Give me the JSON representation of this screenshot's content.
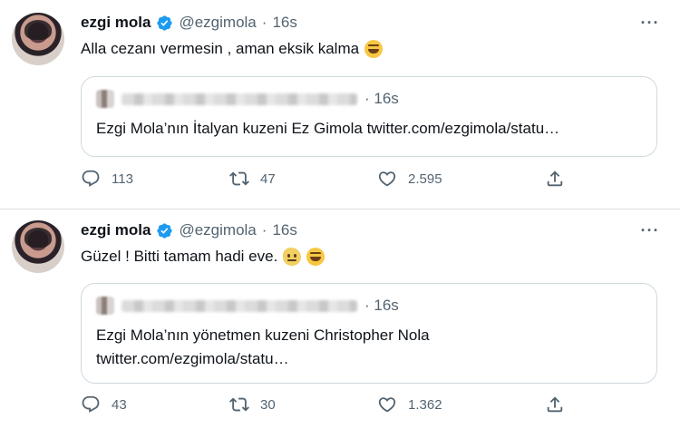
{
  "tweets": [
    {
      "author": {
        "name": "ezgi mola",
        "handle": "@ezgimola",
        "separator": "·",
        "time": "16s"
      },
      "text": "Alla cezanı vermesin , aman eksik kalma",
      "quote": {
        "time": "16s",
        "text": "Ezgi Mola’nın İtalyan kuzeni Ez Gimola twitter.com/ezgimola/statu…"
      },
      "stats": {
        "replies": "113",
        "retweets": "47",
        "likes": "2.595"
      }
    },
    {
      "author": {
        "name": "ezgi mola",
        "handle": "@ezgimola",
        "separator": "·",
        "time": "16s"
      },
      "text": "Güzel ! Bitti tamam hadi eve.",
      "quote": {
        "time": "16s",
        "text_line1": "Ezgi Mola’nın yönetmen kuzeni Christopher Nola",
        "text_line2": "twitter.com/ezgimola/statu…"
      },
      "stats": {
        "replies": "43",
        "retweets": "30",
        "likes": "1.362"
      }
    }
  ],
  "icons": {
    "verified": "verified-badge-icon",
    "more": "more-options-icon",
    "reply": "reply-icon",
    "retweet": "retweet-icon",
    "like": "like-icon",
    "share": "share-icon"
  },
  "colors": {
    "verified": "#1d9bf0",
    "secondary_text": "#536471",
    "border": "#cfd9de"
  }
}
